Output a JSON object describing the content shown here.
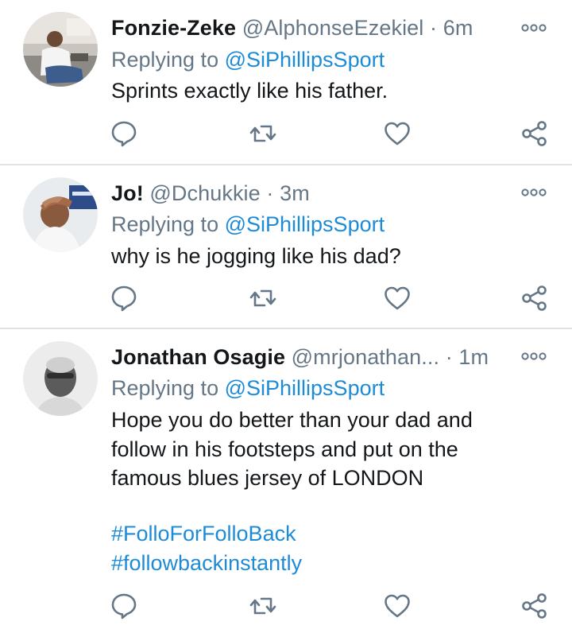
{
  "tweets": [
    {
      "name": "Fonzie-Zeke",
      "handle": "@AlphonseEzekiel",
      "separator": "·",
      "time": "6m",
      "replying_prefix": "Replying to",
      "replying_to": "@SiPhillipsSport",
      "body_lines": [
        "Sprints exactly like his father."
      ],
      "hashtags": [],
      "avatar_icon": "user-avatar-photo"
    },
    {
      "name": "Jo!",
      "handle": "@Dchukkie",
      "separator": "·",
      "time": "3m",
      "replying_prefix": "Replying to",
      "replying_to": "@SiPhillipsSport",
      "body_lines": [
        "why is he jogging like his dad?"
      ],
      "hashtags": [],
      "avatar_icon": "user-avatar-photo"
    },
    {
      "name": "Jonathan Osagie",
      "handle": "@mrjonathan...",
      "separator": "·",
      "time": "1m",
      "replying_prefix": "Replying to",
      "replying_to": "@SiPhillipsSport",
      "body_lines": [
        "Hope you do better than your dad and",
        "follow in his footsteps and put on the",
        "famous blues jersey of LONDON"
      ],
      "hashtags": [
        "#FolloForFolloBack",
        "#followbackinstantly"
      ],
      "avatar_icon": "user-avatar-photo"
    }
  ],
  "action_icons": [
    "reply-icon",
    "retweet-icon",
    "like-icon",
    "share-icon"
  ],
  "colors": {
    "link": "#1d8bd6",
    "secondary_text": "#657786",
    "primary_text": "#14171a",
    "divider": "#dfe3e6"
  }
}
